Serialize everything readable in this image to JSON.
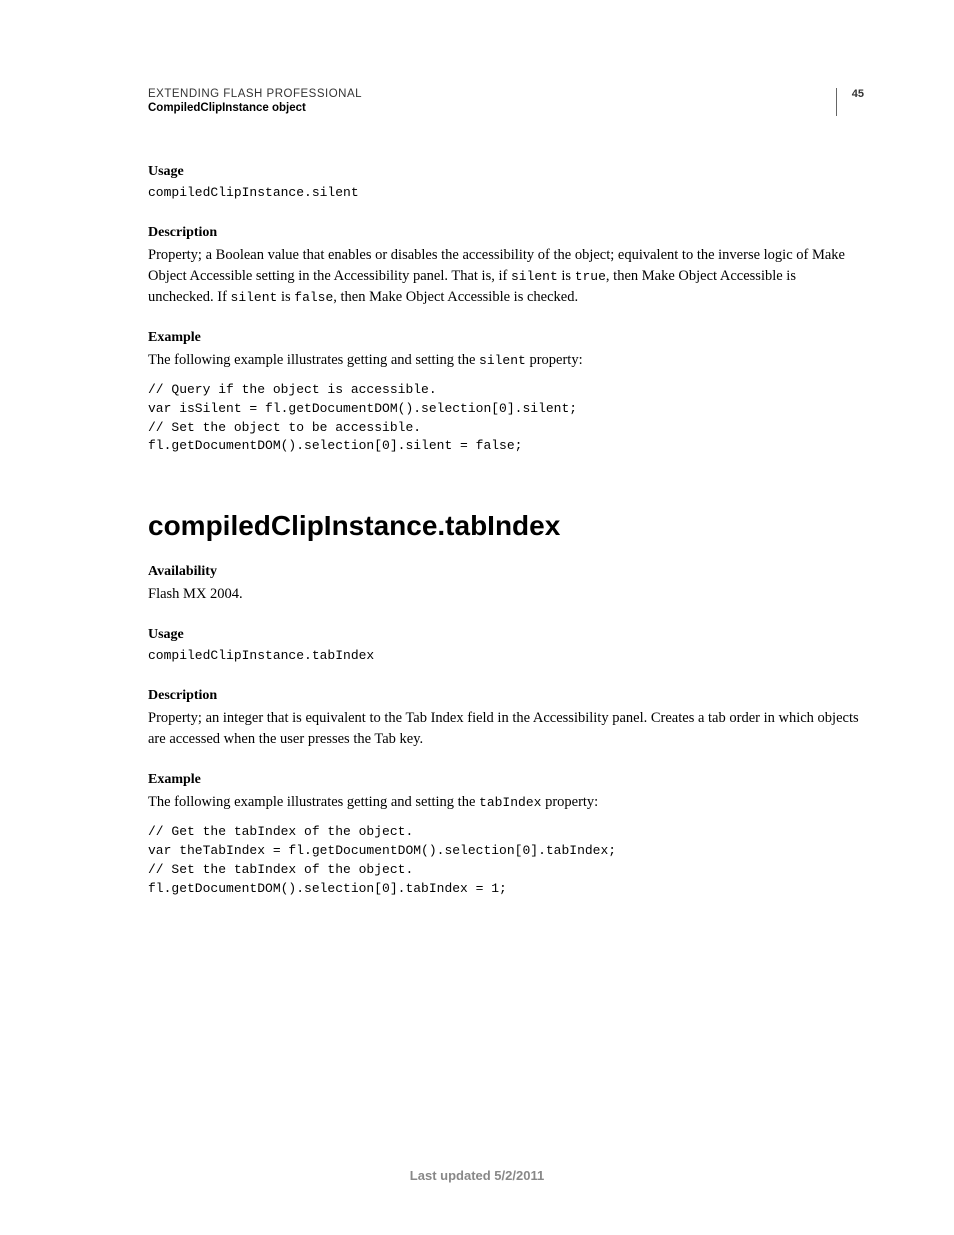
{
  "header": {
    "title": "EXTENDING FLASH PROFESSIONAL",
    "subtitle": "CompiledClipInstance object",
    "page_number": "45"
  },
  "section1": {
    "usage_label": "Usage",
    "usage_code": "compiledClipInstance.silent",
    "description_label": "Description",
    "description_part1": "Property; a Boolean value that enables or disables the accessibility of the object; equivalent to the inverse logic of Make Object Accessible setting in the Accessibility panel. That is, if ",
    "description_code1": "silent",
    "description_part2": " is ",
    "description_code2": "true",
    "description_part3": ", then Make Object Accessible is unchecked. If ",
    "description_code3": "silent",
    "description_part4": " is ",
    "description_code4": "false",
    "description_part5": ", then Make Object Accessible is checked.",
    "example_label": "Example",
    "example_intro_part1": "The following example illustrates getting and setting the ",
    "example_intro_code": "silent",
    "example_intro_part2": " property:",
    "example_code": "// Query if the object is accessible. \nvar isSilent = fl.getDocumentDOM().selection[0].silent; \n// Set the object to be accessible. \nfl.getDocumentDOM().selection[0].silent = false;"
  },
  "section2": {
    "heading": "compiledClipInstance.tabIndex",
    "availability_label": "Availability",
    "availability_text": "Flash MX 2004.",
    "usage_label": "Usage",
    "usage_code": "compiledClipInstance.tabIndex",
    "description_label": "Description",
    "description_text": "Property; an integer that is equivalent to the Tab Index field in the Accessibility panel. Creates a tab order in which objects are accessed when the user presses the Tab key.",
    "example_label": "Example",
    "example_intro_part1": "The following example illustrates getting and setting the ",
    "example_intro_code": "tabIndex",
    "example_intro_part2": " property:",
    "example_code": "// Get the tabIndex of the object. \nvar theTabIndex = fl.getDocumentDOM().selection[0].tabIndex; \n// Set the tabIndex of the object. \nfl.getDocumentDOM().selection[0].tabIndex = 1;"
  },
  "footer": {
    "text": "Last updated 5/2/2011"
  }
}
